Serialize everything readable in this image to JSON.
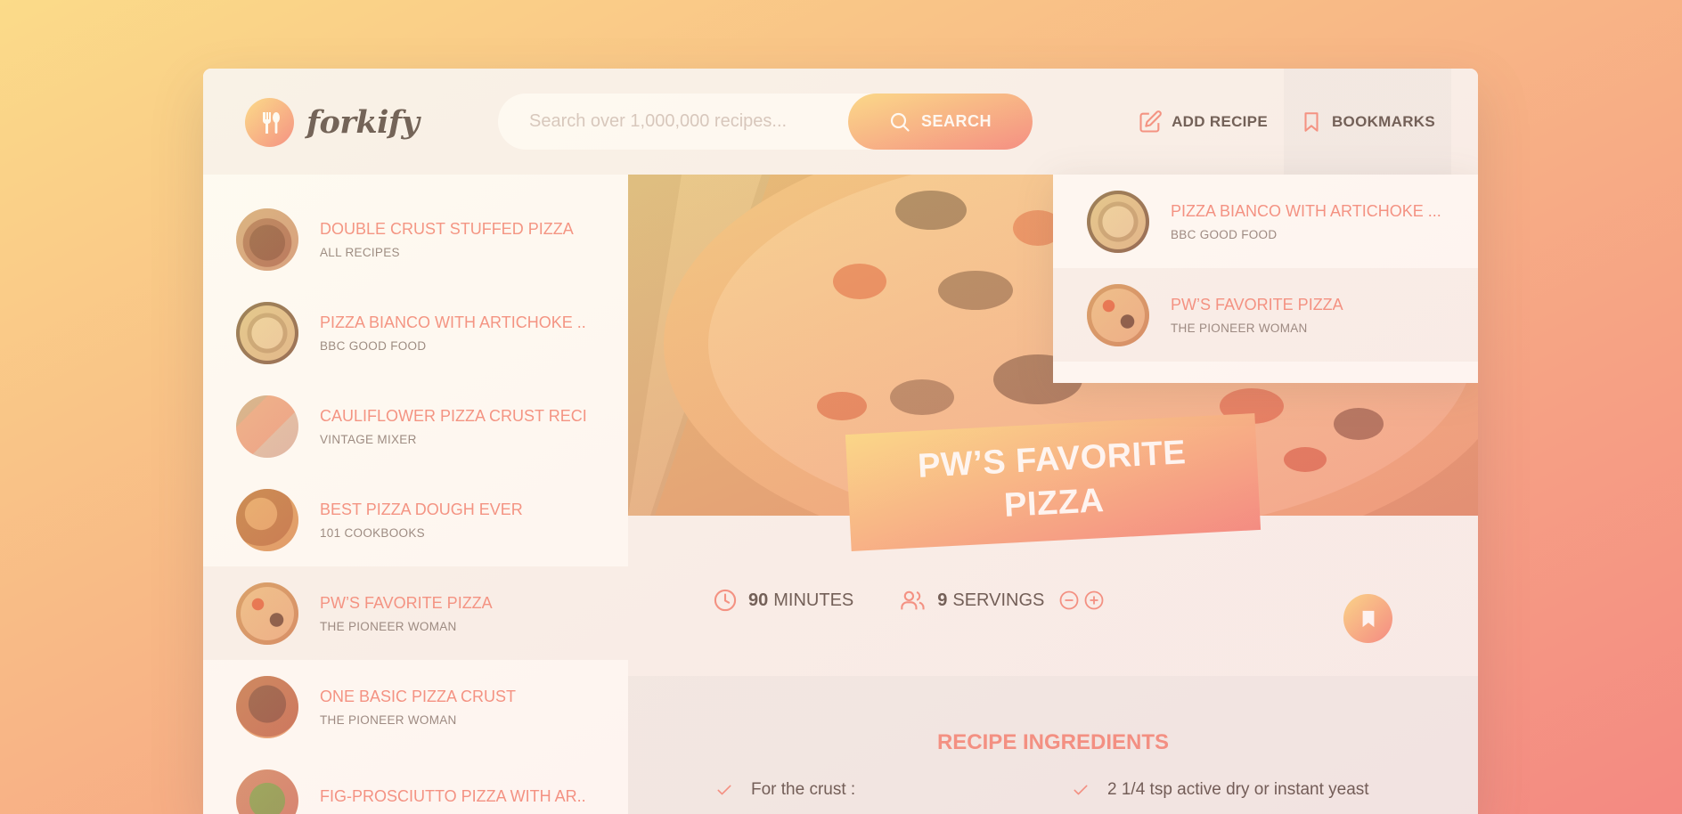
{
  "colors": {
    "accent_start": "#fbdb89",
    "accent_end": "#f48982",
    "primary_text": "#615551",
    "title_text": "#f38e82"
  },
  "header": {
    "logo_text": "forkify",
    "search": {
      "placeholder": "Search over 1,000,000 recipes...",
      "button_label": "SEARCH"
    },
    "nav": {
      "add_recipe_label": "ADD RECIPE",
      "bookmarks_label": "BOOKMARKS"
    }
  },
  "results": [
    {
      "title": "DOUBLE CRUST STUFFED PIZZA",
      "publisher": "ALL RECIPES",
      "thumb": "stuffed"
    },
    {
      "title": "PIZZA BIANCO WITH ARTICHOKE ...",
      "publisher": "BBC GOOD FOOD",
      "thumb": "bianco"
    },
    {
      "title": "CAULIFLOWER PIZZA CRUST RECI...",
      "publisher": "VINTAGE MIXER",
      "thumb": "cauli"
    },
    {
      "title": "BEST PIZZA DOUGH EVER",
      "publisher": "101 COOKBOOKS",
      "thumb": "dough"
    },
    {
      "title": "PW’S FAVORITE PIZZA",
      "publisher": "THE PIONEER WOMAN",
      "thumb": "pw"
    },
    {
      "title": "ONE BASIC PIZZA CRUST",
      "publisher": "THE PIONEER WOMAN",
      "thumb": "basic"
    },
    {
      "title": "FIG-PROSCIUTTO PIZZA WITH AR...",
      "publisher": "",
      "thumb": "fig"
    }
  ],
  "bookmarks": [
    {
      "title": "PIZZA BIANCO WITH ARTICHOKE ...",
      "publisher": "BBC GOOD FOOD",
      "thumb": "bianco"
    },
    {
      "title": "PW’S FAVORITE PIZZA",
      "publisher": "THE PIONEER WOMAN",
      "thumb": "pw"
    }
  ],
  "recipe": {
    "title": "PW’S FAVORITE PIZZA",
    "minutes": "90",
    "minutes_label": "MINUTES",
    "servings": "9",
    "servings_label": "SERVINGS",
    "ingredients_heading": "RECIPE INGREDIENTS",
    "ingredients": [
      "For the crust :",
      "2 1/4 tsp active dry or instant yeast"
    ]
  }
}
